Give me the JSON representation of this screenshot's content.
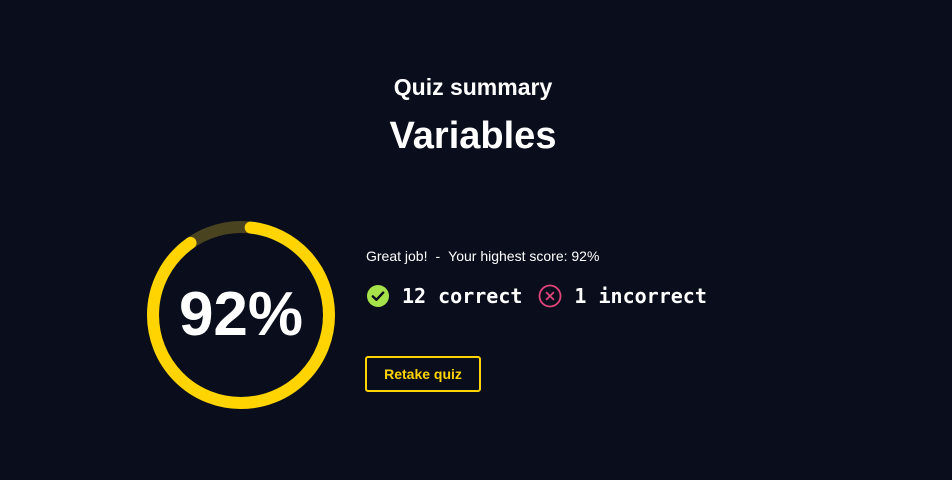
{
  "header": {
    "subtitle": "Quiz summary",
    "title": "Variables"
  },
  "score": {
    "percent_label": "92%",
    "fraction": 0.92,
    "ring_color": "#ffd400",
    "ring_track_color": "#4a4320"
  },
  "summary": {
    "message": "Great job!",
    "separator": "-",
    "highest_score": "Your highest score: 92%",
    "correct_label": "12 correct",
    "incorrect_label": "1 incorrect",
    "correct_icon": "check-circle-icon",
    "incorrect_icon": "x-circle-icon",
    "correct_color": "#a6e34a",
    "incorrect_color": "#e0457b"
  },
  "actions": {
    "retake_label": "Retake quiz"
  }
}
